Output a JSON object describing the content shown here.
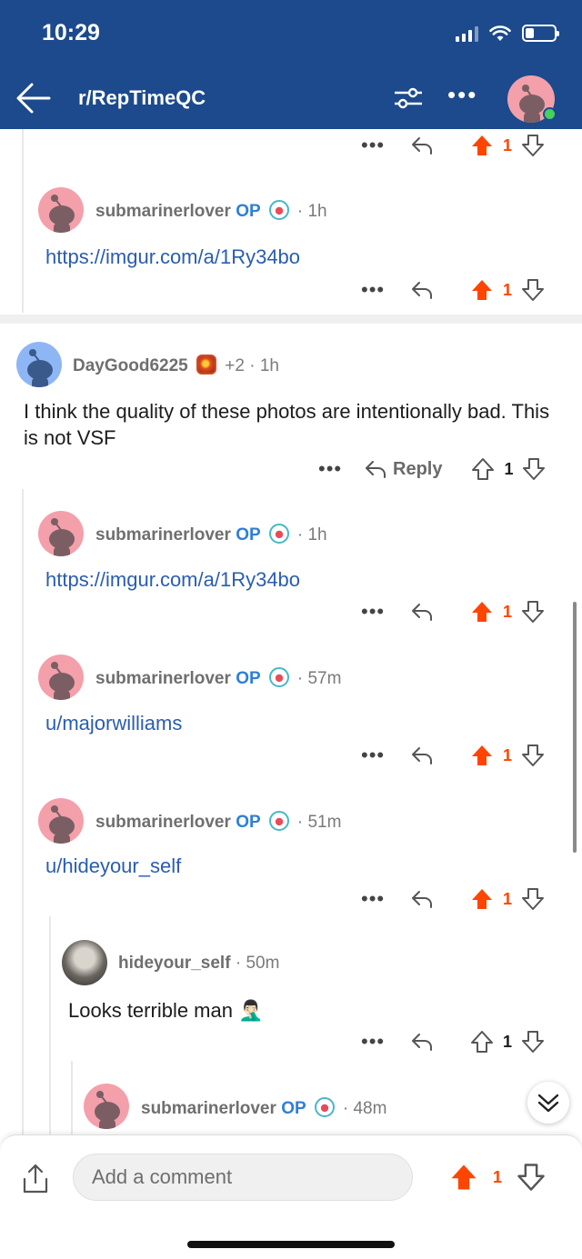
{
  "status": {
    "time": "10:29"
  },
  "header": {
    "subreddit": "r/RepTimeQC"
  },
  "comments": [
    {
      "user": "submarinerlover",
      "op": "OP",
      "time": "1h",
      "link": "https://imgur.com/a/1Ry34bo",
      "score": "1"
    },
    {
      "user": "DayGood6225",
      "flair_score": "+2",
      "time": "1h",
      "text": "I think the quality of these photos are intentionally bad. This is not VSF",
      "reply_label": "Reply",
      "score": "1"
    },
    {
      "user": "submarinerlover",
      "op": "OP",
      "time": "1h",
      "link": "https://imgur.com/a/1Ry34bo",
      "score": "1"
    },
    {
      "user": "submarinerlover",
      "op": "OP",
      "time": "57m",
      "link": "u/majorwilliams",
      "score": "1"
    },
    {
      "user": "submarinerlover",
      "op": "OP",
      "time": "51m",
      "link": "u/hideyour_self",
      "score": "1"
    },
    {
      "user": "hideyour_self",
      "time": "50m",
      "text": "Looks terrible man",
      "emoji": "🤦🏻‍♂️",
      "score": "1"
    },
    {
      "user": "submarinerlover",
      "op": "OP",
      "time": "48m"
    }
  ],
  "top_actions": {
    "score": "1"
  },
  "bottom_bar": {
    "placeholder": "Add a comment",
    "score": "1"
  },
  "colors": {
    "header": "#1c4a8c",
    "upvote": "#ff4500",
    "link": "#2a5db0",
    "op": "#2f7fd6"
  }
}
